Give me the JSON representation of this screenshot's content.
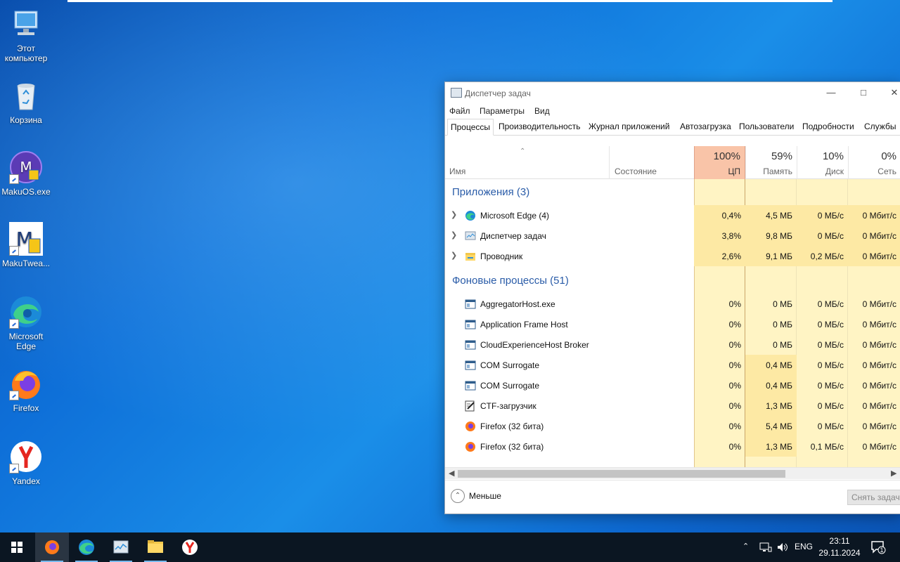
{
  "desktop": {
    "icons": [
      {
        "label": "Этот компьютер"
      },
      {
        "label": "Корзина"
      },
      {
        "label": "MakuOS.exe"
      },
      {
        "label": "MakuTwea..."
      },
      {
        "label": "Microsoft Edge"
      },
      {
        "label": "Firefox"
      },
      {
        "label": "Yandex"
      }
    ]
  },
  "window": {
    "title": "Диспетчер задач",
    "menu": [
      "Файл",
      "Параметры",
      "Вид"
    ],
    "tabs": [
      "Процессы",
      "Производительность",
      "Журнал приложений",
      "Автозагрузка",
      "Пользователи",
      "Подробности",
      "Службы"
    ],
    "active_tab": "Процессы",
    "columns": {
      "name": "Имя",
      "status": "Состояние",
      "cpu": {
        "pct": "100%",
        "label": "ЦП"
      },
      "memory": {
        "pct": "59%",
        "label": "Память"
      },
      "disk": {
        "pct": "10%",
        "label": "Диск"
      },
      "network": {
        "pct": "0%",
        "label": "Сеть"
      }
    },
    "groups": {
      "apps": {
        "title": "Приложения (3)",
        "rows": [
          {
            "name": "Microsoft Edge (4)",
            "icon": "edge-icon",
            "cpu": "0,4%",
            "mem": "4,5 МБ",
            "disk": "0 МБ/с",
            "net": "0 Мбит/с"
          },
          {
            "name": "Диспетчер задач",
            "icon": "task-manager-icon",
            "cpu": "3,8%",
            "mem": "9,8 МБ",
            "disk": "0 МБ/с",
            "net": "0 Мбит/с"
          },
          {
            "name": "Проводник",
            "icon": "explorer-folder-icon",
            "cpu": "2,6%",
            "mem": "9,1 МБ",
            "disk": "0,2 МБ/с",
            "net": "0 Мбит/с"
          }
        ]
      },
      "background": {
        "title": "Фоновые процессы (51)",
        "rows": [
          {
            "name": "AggregatorHost.exe",
            "icon": "window-app-icon",
            "cpu": "0%",
            "mem": "0 МБ",
            "disk": "0 МБ/с",
            "net": "0 Мбит/с"
          },
          {
            "name": "Application Frame Host",
            "icon": "window-app-icon",
            "cpu": "0%",
            "mem": "0 МБ",
            "disk": "0 МБ/с",
            "net": "0 Мбит/с"
          },
          {
            "name": "CloudExperienceHost Broker",
            "icon": "window-app-icon",
            "cpu": "0%",
            "mem": "0 МБ",
            "disk": "0 МБ/с",
            "net": "0 Мбит/с"
          },
          {
            "name": "COM Surrogate",
            "icon": "window-app-icon",
            "cpu": "0%",
            "mem": "0,4 МБ",
            "disk": "0 МБ/с",
            "net": "0 Мбит/с"
          },
          {
            "name": "COM Surrogate",
            "icon": "window-app-icon",
            "cpu": "0%",
            "mem": "0,4 МБ",
            "disk": "0 МБ/с",
            "net": "0 Мбит/с"
          },
          {
            "name": "CTF-загрузчик",
            "icon": "ctf-loader-icon",
            "cpu": "0%",
            "mem": "1,3 МБ",
            "disk": "0 МБ/с",
            "net": "0 Мбит/с"
          },
          {
            "name": "Firefox (32 бита)",
            "icon": "firefox-icon",
            "cpu": "0%",
            "mem": "5,4 МБ",
            "disk": "0 МБ/с",
            "net": "0 Мбит/с"
          },
          {
            "name": "Firefox (32 бита)",
            "icon": "firefox-icon",
            "cpu": "0%",
            "mem": "1,3 МБ",
            "disk": "0,1 МБ/с",
            "net": "0 Мбит/с"
          }
        ]
      }
    },
    "footer": {
      "less_label": "Меньше",
      "end_task_label": "Снять задачу"
    }
  },
  "taskbar": {
    "apps": [
      "firefox-icon",
      "edge-icon",
      "task-manager-icon",
      "explorer-folder-icon",
      "yandex-icon"
    ],
    "language": "ENG",
    "time": "23:11",
    "date": "29.11.2024",
    "notification_count": "1"
  },
  "colors": {
    "cpu_header": "#f9c4a8",
    "cell_heat_light": "#fff4c4",
    "cell_heat_mid": "#fde9a4",
    "group_title": "#2a5ca8",
    "taskbar": "#0b1622"
  }
}
